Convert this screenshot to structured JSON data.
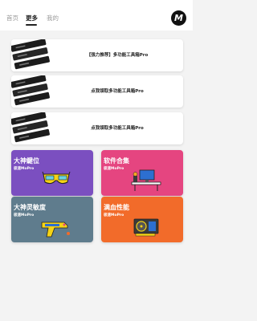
{
  "tabs": [
    {
      "label": "首页",
      "active": false
    },
    {
      "label": "更多",
      "active": true
    },
    {
      "label": "我的",
      "active": false
    }
  ],
  "logo_letter": "M",
  "banners": [
    {
      "text": "【强力推荐】多功能工具箱Pro"
    },
    {
      "text": "点我領取多功能工具箱Pro"
    },
    {
      "text": "点我領取多功能工具箱Pro"
    }
  ],
  "cards": [
    {
      "title": "大神鍵位",
      "subtitle": "极速MoPro",
      "color": "#7b4fc0",
      "icon": "glasses-icon"
    },
    {
      "title": "软件合集",
      "subtitle": "极速MoPro",
      "color": "#e54580",
      "icon": "desk-computer-icon"
    },
    {
      "title": "大神灵敏度",
      "subtitle": "极速MoPro",
      "color": "#5f7c8d",
      "icon": "gun-icon"
    },
    {
      "title": "满血性能",
      "subtitle": "极速MoPro",
      "color": "#f26b2a",
      "icon": "graphics-card-icon"
    }
  ]
}
